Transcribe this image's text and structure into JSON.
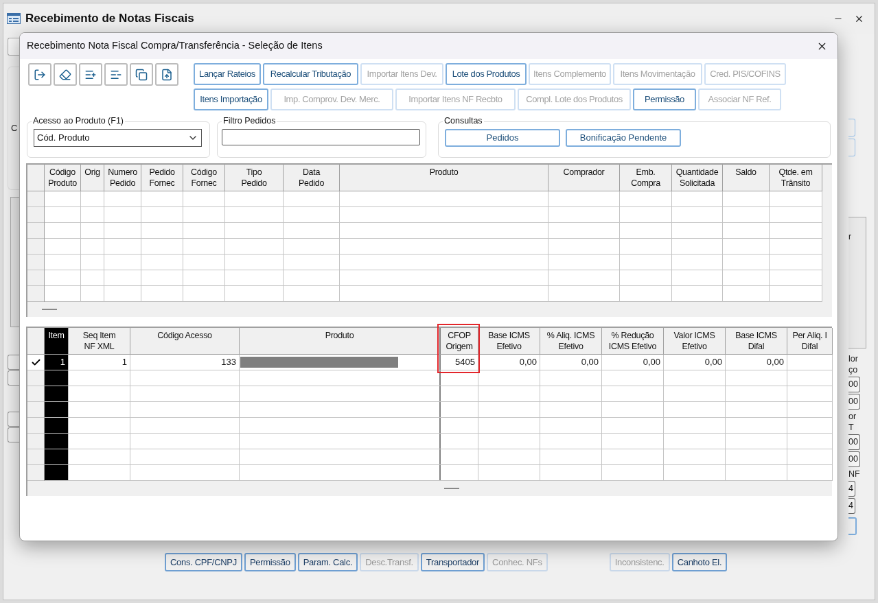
{
  "main_window": {
    "title": "Recebimento de Notas Fiscais",
    "left_fragment": "C",
    "grid_fragment": "r",
    "right_fragments": [
      {
        "kind": "label",
        "lines": [
          "lor",
          "ço"
        ]
      },
      {
        "kind": "field",
        "text": "00"
      },
      {
        "kind": "field",
        "text": "00"
      },
      {
        "kind": "label",
        "lines": [
          "or",
          "T"
        ]
      },
      {
        "kind": "field",
        "text": "00"
      },
      {
        "kind": "field",
        "text": "00"
      },
      {
        "kind": "label",
        "lines": [
          "NF"
        ]
      },
      {
        "kind": "field",
        "text": "4"
      },
      {
        "kind": "field",
        "text": "4"
      }
    ],
    "bottom_buttons": [
      [
        {
          "label": "Cons. CPF/CNPJ",
          "disabled": false
        },
        {
          "label": "Permissão",
          "disabled": false
        },
        {
          "label": "Param. Calc.",
          "disabled": false
        },
        {
          "label": "Desc.Transf.",
          "disabled": true
        },
        {
          "label": "Transportador",
          "disabled": false
        },
        {
          "label": "Conhec. NFs",
          "disabled": true
        }
      ],
      [
        {
          "label": "Inconsistenc.",
          "disabled": true
        },
        {
          "label": "Canhoto El.",
          "disabled": false
        }
      ]
    ]
  },
  "dialog": {
    "title": "Recebimento Nota Fiscal Compra/Transferência - Seleção de Itens",
    "toolbar_rows": [
      [
        {
          "label": "Lançar Rateios",
          "disabled": false
        },
        {
          "label": "Recalcular Tributação",
          "disabled": false
        },
        {
          "label": "Importar Itens Dev.",
          "disabled": true
        },
        {
          "label": "Lote dos Produtos",
          "disabled": false
        },
        {
          "label": "Itens Complemento",
          "disabled": true
        },
        {
          "label": "Itens Movimentação",
          "disabled": true
        },
        {
          "label": "Cred. PIS/COFINS",
          "disabled": true
        }
      ],
      [
        {
          "label": "Itens Importação",
          "disabled": false
        },
        {
          "label": "Imp. Comprov. Dev. Merc.",
          "disabled": true
        },
        {
          "label": "Importar Itens NF Recbto",
          "disabled": true
        },
        {
          "label": "Compl. Lote dos Produtos",
          "disabled": true
        },
        {
          "label": "Permissão",
          "disabled": false
        },
        {
          "label": "Associar NF Ref.",
          "disabled": true
        }
      ]
    ],
    "product_access": {
      "legend": "Acesso ao Produto (F1)",
      "value": "Cód. Produto"
    },
    "order_filter": {
      "legend": "Filtro Pedidos"
    },
    "queries": {
      "legend": "Consultas",
      "buttons": [
        "Pedidos",
        "Bonificação Pendente"
      ]
    },
    "orders_grid": {
      "columns": [
        {
          "lines": [
            "Código",
            "Produto"
          ]
        },
        {
          "lines": [
            "Orig"
          ]
        },
        {
          "lines": [
            "Numero",
            "Pedido"
          ]
        },
        {
          "lines": [
            "Pedido",
            "Fornec"
          ]
        },
        {
          "lines": [
            "Código",
            "Fornec"
          ]
        },
        {
          "lines": [
            "Tipo",
            "Pedido"
          ]
        },
        {
          "lines": [
            "Data",
            "Pedido"
          ]
        },
        {
          "lines": [
            "Produto"
          ]
        },
        {
          "lines": [
            "Comprador"
          ]
        },
        {
          "lines": [
            "Emb.",
            "Compra"
          ]
        },
        {
          "lines": [
            "Quantidade",
            "Solicitada"
          ]
        },
        {
          "lines": [
            "Saldo"
          ]
        },
        {
          "lines": [
            "Qtde. em",
            "Trânsito"
          ]
        }
      ]
    },
    "items_grid": {
      "columns": [
        {
          "lines": [
            "Item"
          ],
          "highlighted": false
        },
        {
          "lines": [
            "Seq Item",
            "NF XML"
          ],
          "highlighted": false
        },
        {
          "lines": [
            "Código Acesso"
          ],
          "highlighted": false
        },
        {
          "lines": [
            "Produto"
          ],
          "highlighted": false
        },
        {
          "lines": [
            "CFOP",
            "Origem"
          ],
          "highlighted": true
        },
        {
          "lines": [
            "Base ICMS",
            "Efetivo"
          ],
          "highlighted": false
        },
        {
          "lines": [
            "% Aliq. ICMS",
            "Efetivo"
          ],
          "highlighted": false
        },
        {
          "lines": [
            "% Redução",
            "ICMS Efetivo"
          ],
          "highlighted": false
        },
        {
          "lines": [
            "Valor ICMS",
            "Efetivo"
          ],
          "highlighted": false
        },
        {
          "lines": [
            "Base ICMS",
            "Difal"
          ],
          "highlighted": false
        },
        {
          "lines": [
            "Per Aliq. I",
            "Difal"
          ],
          "highlighted": false
        }
      ],
      "rows": [
        {
          "current": true,
          "cells": [
            {
              "kind": "text",
              "text": "1"
            },
            {
              "kind": "text",
              "text": "1"
            },
            {
              "kind": "text",
              "text": "133"
            },
            {
              "kind": "redacted"
            },
            {
              "kind": "text",
              "text": "5405"
            },
            {
              "kind": "text",
              "text": "0,00"
            },
            {
              "kind": "text",
              "text": "0,00"
            },
            {
              "kind": "text",
              "text": "0,00"
            },
            {
              "kind": "text",
              "text": "0,00"
            },
            {
              "kind": "text",
              "text": "0,00"
            }
          ]
        }
      ]
    }
  }
}
